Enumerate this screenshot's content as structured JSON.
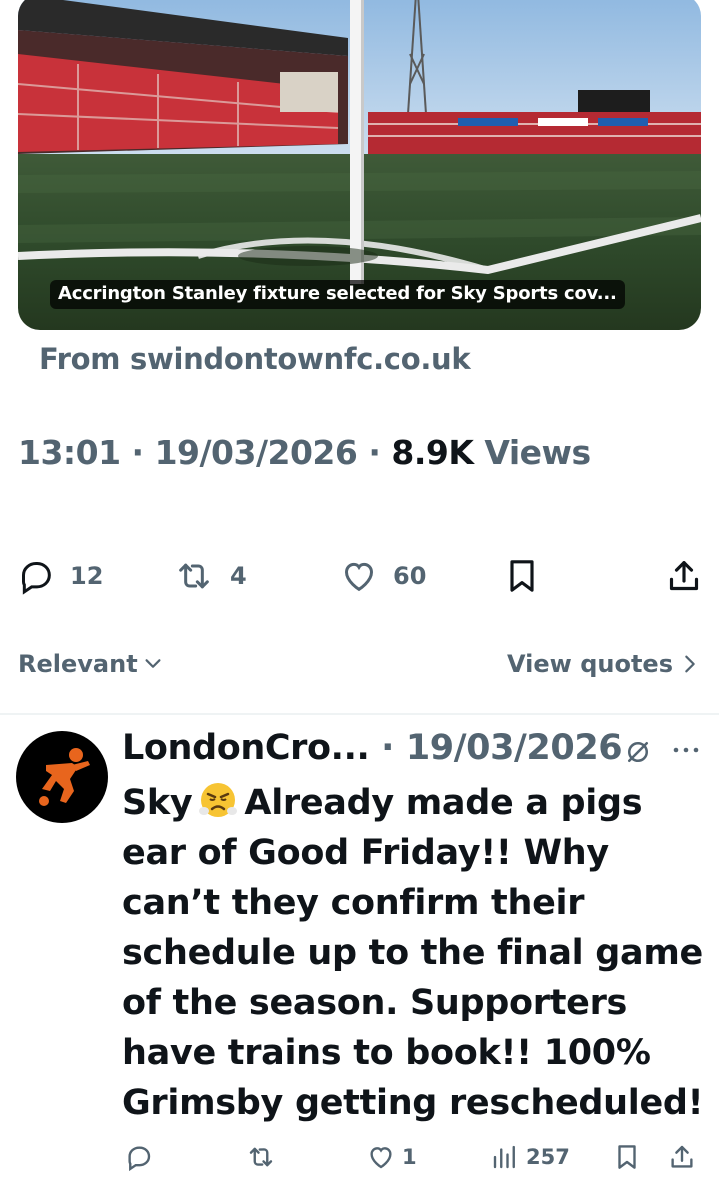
{
  "link_card": {
    "caption": "Accrington Stanley fixture selected for Sky Sports cov...",
    "source": "From swindontownfc.co.uk",
    "image_icon": "stadium-photo"
  },
  "tweet_meta": {
    "time": "13:01",
    "sep1": " · ",
    "date": "19/03/2026",
    "sep2": " · ",
    "views_count": "8.9K",
    "views_label": " Views"
  },
  "actions": {
    "replies": "12",
    "reposts": "4",
    "likes": "60"
  },
  "sort": {
    "label": "Relevant",
    "view_quotes": "View quotes"
  },
  "reply": {
    "name": "LondonCro...",
    "sep": " · ",
    "date": "19/03/2026",
    "text_before_emoji": "Sky",
    "text_after_emoji": "Already made a pigs ear of Good Friday!! Why can’t they confirm their schedule up to the final game of the season. Supporters have trains to book!! 100% Grimsby getting rescheduled!",
    "emoji_icon": "face-with-steam-from-nose",
    "likes": "1",
    "views": "257"
  },
  "colors": {
    "text": "#0f1419",
    "secondary": "#536471",
    "divider": "#eff3f4",
    "avatar_accent": "#e8651d"
  }
}
